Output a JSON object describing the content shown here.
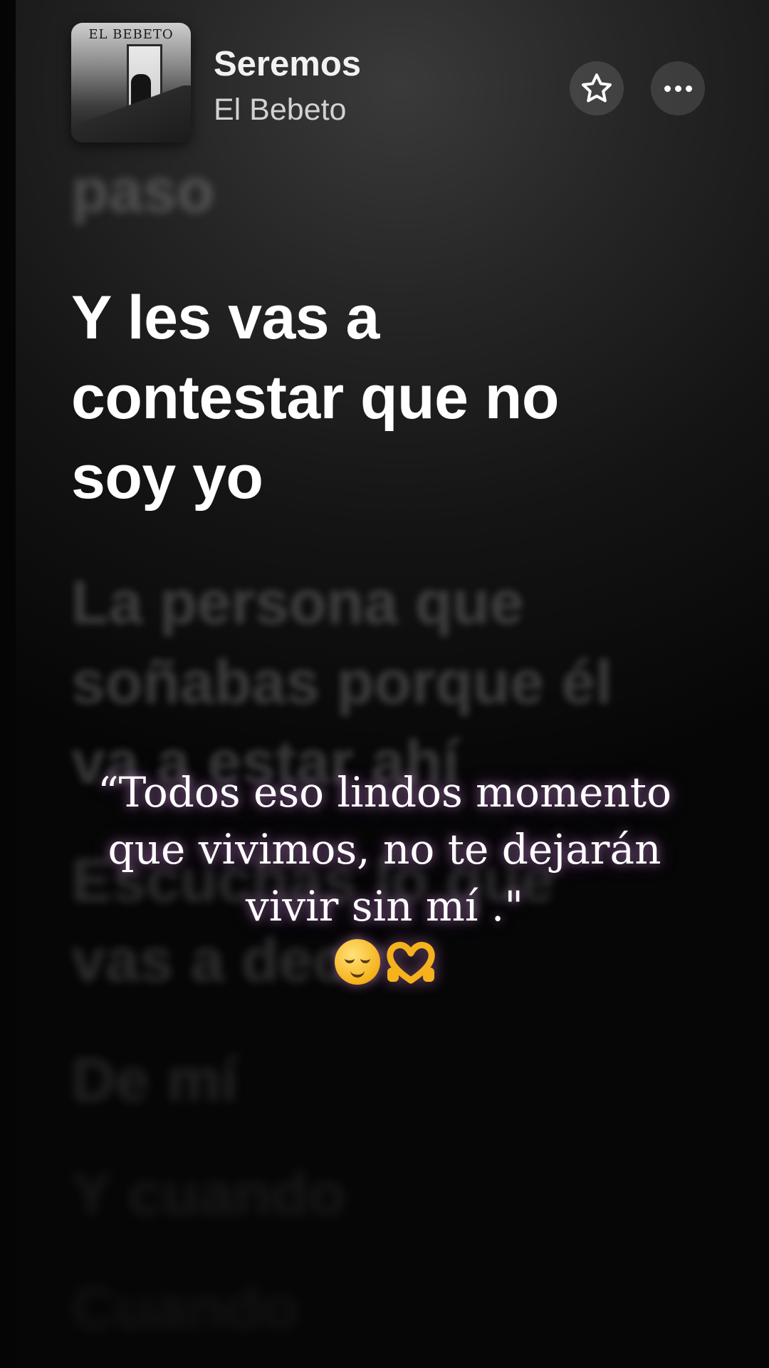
{
  "header": {
    "title": "Seremos",
    "artist": "El Bebeto",
    "cover_text": "EL BEBETO"
  },
  "icons": {
    "favorite": "star-icon",
    "more": "more-dots-icon"
  },
  "lyrics": {
    "previous": "paso",
    "current": "Y les vas a contestar que no soy yo",
    "next": "La persona que soñabas porque él va a estar ahí",
    "next2": "Escuchas lo que vas a decir",
    "next3": "De mí",
    "next4": "Y cuando",
    "next5": "Cuando"
  },
  "quote": {
    "line1": "“Todos eso lindos momento",
    "line2": "que vivimos, no te dejarán",
    "line3": "vivir sin mí .\"",
    "emojis": "😌🫶"
  },
  "colors": {
    "background": "#000000",
    "text": "#ffffff",
    "glow": "#d48cff"
  }
}
